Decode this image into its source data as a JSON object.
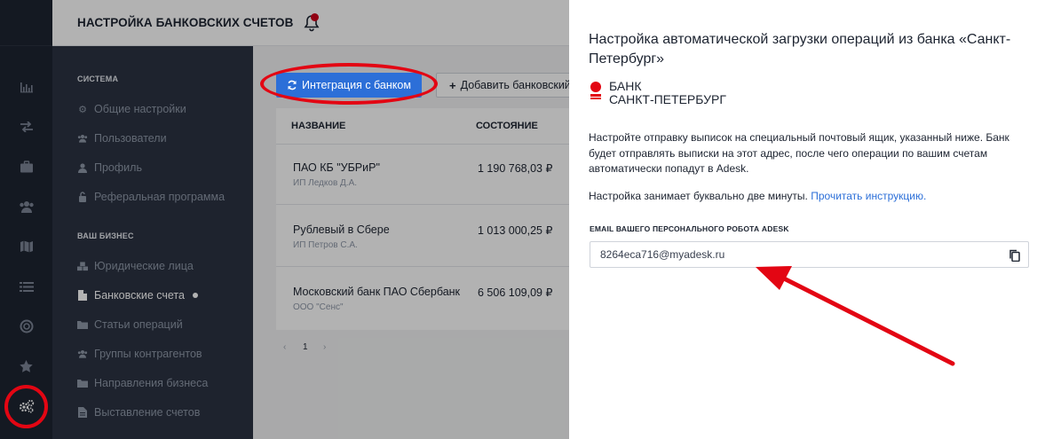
{
  "header": {
    "title": "НАСТРОЙКА БАНКОВСКИХ СЧЕТОВ"
  },
  "rail": {
    "icons": [
      "chart-icon",
      "transfer-icon",
      "briefcase-icon",
      "users-icon",
      "map-icon",
      "list-icon",
      "lifebuoy-icon",
      "star-icon",
      "settings-gears-icon"
    ]
  },
  "nav": {
    "system_title": "СИСТЕМА",
    "system_items": [
      {
        "label": "Общие настройки",
        "icon": "gear-icon"
      },
      {
        "label": "Пользователи",
        "icon": "users-icon"
      },
      {
        "label": "Профиль",
        "icon": "user-icon"
      },
      {
        "label": "Реферальная программа",
        "icon": "unlock-icon"
      }
    ],
    "business_title": "ВАШ БИЗНЕС",
    "business_items": [
      {
        "label": "Юридические лица",
        "icon": "cubes-icon"
      },
      {
        "label": "Банковские счета",
        "icon": "file-icon"
      },
      {
        "label": "Статьи операций",
        "icon": "folder-icon"
      },
      {
        "label": "Группы контрагентов",
        "icon": "users-icon"
      },
      {
        "label": "Направления бизнеса",
        "icon": "folder-icon"
      },
      {
        "label": "Выставление счетов",
        "icon": "file-text-icon"
      }
    ]
  },
  "toolbar": {
    "integration_label": "Интеграция с банком",
    "add_label": "Добавить банковский"
  },
  "table": {
    "columns": [
      "НАЗВАНИЕ",
      "СОСТОЯНИЕ"
    ],
    "rows": [
      {
        "name": "ПАО КБ \"УБРиР\"",
        "owner": "ИП Ледков Д.А.",
        "balance": "1 190 768,03 ₽"
      },
      {
        "name": "Рублевый в Сбере",
        "owner": "ИП Петров С.А.",
        "balance": "1 013 000,25 ₽"
      },
      {
        "name": "Московский банк ПАО Сбербанк",
        "owner": "ООО \"Сенс\"",
        "balance": "6 506 109,09 ₽"
      }
    ]
  },
  "pager": {
    "prev": "‹",
    "current": "1",
    "next": "›"
  },
  "panel": {
    "title": "Настройка автоматической загрузки операций из банка «Санкт-Петербург»",
    "bank_line1": "БАНК",
    "bank_line2": "САНКТ-ПЕТЕРБУРГ",
    "description": "Настройте отправку выписок на специальный почтовый ящик, указанный ниже. Банк будет отправлять выписки на этот адрес, после чего операции по вашим счетам автоматически попадут в Adesk.",
    "setup_note": "Настройка занимает буквально две минуты.",
    "instruction_link": "Прочитать инструкцию.",
    "email_label": "EMAIL ВАШЕГО ПЕРСОНАЛЬНОГО РОБОТА ADESK",
    "email_value": "8264eca716@myadesk.ru"
  },
  "colors": {
    "accent": "#2c6fd8",
    "annotation_red": "#e30613",
    "sidebar_dark": "#2b3342",
    "rail_dark": "#1d2431"
  }
}
